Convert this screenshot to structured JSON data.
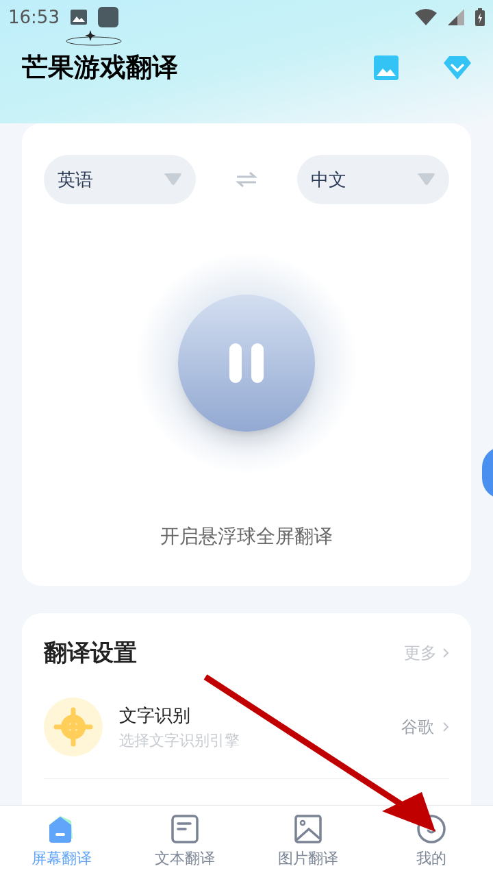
{
  "status_bar": {
    "time": "16:53"
  },
  "header": {
    "title": "芒果游戏翻译"
  },
  "languages": {
    "source": "英语",
    "target": "中文"
  },
  "toggle": {
    "on": false,
    "caption": "开启悬浮球全屏翻译"
  },
  "settings": {
    "title": "翻译设置",
    "more": "更多",
    "items": [
      {
        "title": "文字识别",
        "subtitle": "选择文字识别引擎",
        "value": "谷歌"
      }
    ]
  },
  "tabs": [
    {
      "label": "屏幕翻译",
      "selected": true,
      "kind": "screen"
    },
    {
      "label": "文本翻译",
      "selected": false,
      "kind": "text"
    },
    {
      "label": "图片翻译",
      "selected": false,
      "kind": "image"
    },
    {
      "label": "我的",
      "selected": false,
      "kind": "me"
    }
  ]
}
